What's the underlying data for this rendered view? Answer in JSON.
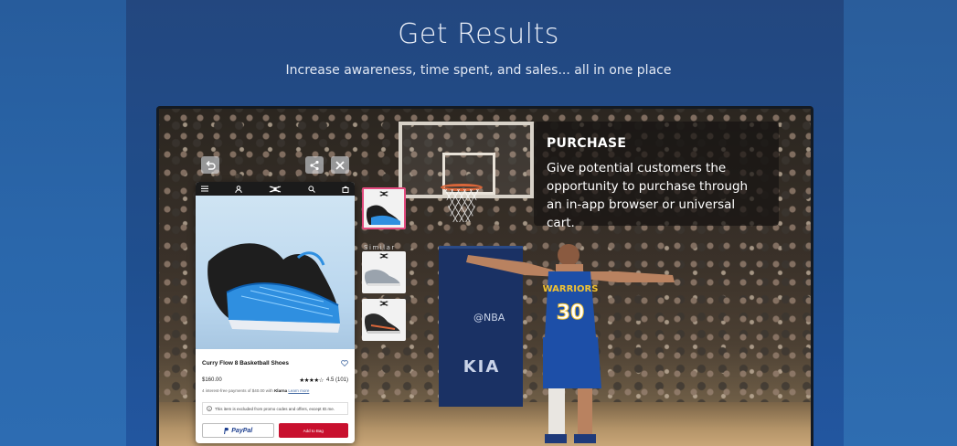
{
  "header": {
    "title": "Get Results",
    "subtitle": "Increase awareness, time spent, and sales... all in one place"
  },
  "info_card": {
    "title": "PURCHASE",
    "body": "Give potential customers the opportunity to purchase through an in-app browser or universal cart."
  },
  "player": {
    "team_text": "WARRIORS",
    "number": "30"
  },
  "arena": {
    "sponsor_text": "KIA",
    "league_text": "@NBA"
  },
  "controls": [
    "back-icon",
    "share-icon",
    "close-icon"
  ],
  "product": {
    "name": "Curry Flow 8 Basketball Shoes",
    "price": "$160.00",
    "stars": "★★★★☆",
    "rating": "4.5 (101)",
    "installments_prefix": "4 interest-free payments of $40.00 with",
    "installments_brand": "Klarna",
    "installments_link": "Learn more",
    "exclusion_note": "This item is excluded from promo codes and offers, except ID.me.",
    "paypal_label": "PayPal",
    "add_to_bag_label": "Add to Bag"
  },
  "similar": {
    "label": "Similar"
  },
  "colors": {
    "brand_red": "#c8102e",
    "thumb_highlight": "#e34a7e",
    "paypal_blue": "#1d3f8f",
    "page_blue": "#1f4f8f"
  }
}
